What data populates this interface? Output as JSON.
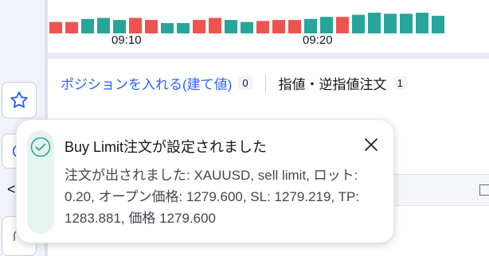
{
  "chart": {
    "time_labels": [
      "09:10",
      "09:20"
    ],
    "volume_bars": [
      {
        "v": 0.55,
        "c": "red"
      },
      {
        "v": 0.55,
        "c": "red"
      },
      {
        "v": 0.7,
        "c": "green"
      },
      {
        "v": 0.75,
        "c": "green"
      },
      {
        "v": 0.65,
        "c": "green"
      },
      {
        "v": 0.75,
        "c": "red"
      },
      {
        "v": 0.65,
        "c": "red"
      },
      {
        "v": 0.5,
        "c": "green"
      },
      {
        "v": 0.5,
        "c": "green"
      },
      {
        "v": 0.65,
        "c": "red"
      },
      {
        "v": 0.75,
        "c": "red"
      },
      {
        "v": 0.65,
        "c": "green"
      },
      {
        "v": 0.55,
        "c": "green"
      },
      {
        "v": 0.6,
        "c": "red"
      },
      {
        "v": 0.65,
        "c": "red"
      },
      {
        "v": 0.65,
        "c": "red"
      },
      {
        "v": 0.7,
        "c": "green"
      },
      {
        "v": 0.8,
        "c": "green"
      },
      {
        "v": 0.8,
        "c": "red"
      },
      {
        "v": 0.9,
        "c": "green"
      },
      {
        "v": 1.0,
        "c": "green"
      },
      {
        "v": 0.95,
        "c": "green"
      },
      {
        "v": 0.95,
        "c": "green"
      },
      {
        "v": 1.0,
        "c": "green"
      },
      {
        "v": 0.85,
        "c": "green"
      }
    ],
    "colors": {
      "up": "#26a69a",
      "down": "#ef5350"
    }
  },
  "panel": {
    "tabs": [
      {
        "label": "ポジションを入れる(建て値)",
        "count": "0"
      },
      {
        "label": "指値・逆指値注文",
        "count": "1"
      }
    ]
  },
  "toast": {
    "title": "Buy Limit注文が設定されました",
    "message": "注文が出されました: XAUUSD, sell limit, ロット: 0.20, オープン価格: 1279.600, SL: 1279.219, TP: 1283.881, 価格 1279.600",
    "accent": "#22ab94"
  },
  "toolbar": {
    "icons": [
      "star-icon",
      "refresh-icon",
      "chevron-left-icon",
      "bottom-tool-icon"
    ]
  }
}
